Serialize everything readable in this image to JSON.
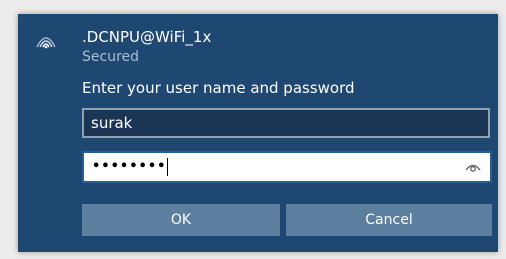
{
  "network": {
    "name": ".DCNPU@WiFi_1x",
    "status": "Secured",
    "icon": "wifi-signal-icon"
  },
  "auth": {
    "prompt": "Enter your user name and password",
    "username_value": "surak",
    "password_mask": "••••••••",
    "reveal_icon": "eye-icon"
  },
  "buttons": {
    "ok": "OK",
    "cancel": "Cancel"
  },
  "colors": {
    "panel_bg": "#1e4872",
    "button_bg": "#5c7e9f",
    "status_text": "#a7bed3"
  }
}
